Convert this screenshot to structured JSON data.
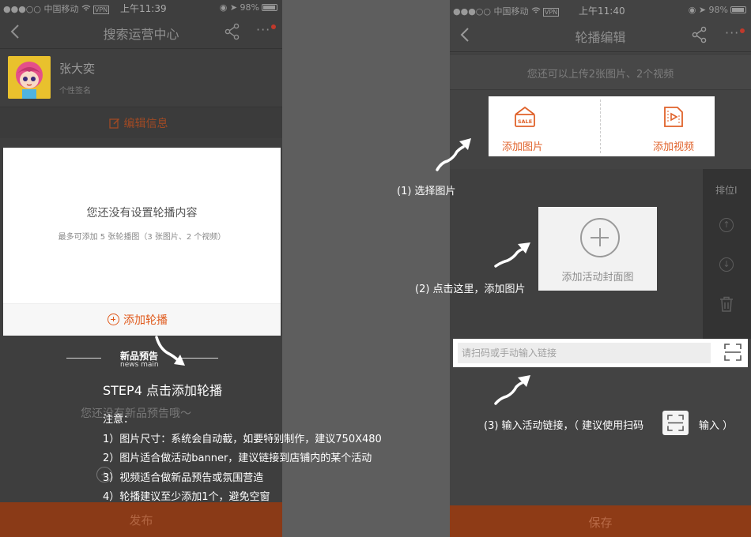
{
  "left_phone": {
    "status": {
      "carrier": "●●●○○ 中国移动",
      "vpn": "VPN",
      "time": "上午11:39",
      "battery": "98%"
    },
    "nav": {
      "title": "搜索运营中心",
      "more": "···"
    },
    "profile": {
      "name": "张大奕",
      "signature": "个性签名"
    },
    "edit_label": "编辑信息",
    "carousel_card": {
      "empty_title": "您还没有设置轮播内容",
      "empty_hint": "最多可添加 5 张轮播图（3 张图片、2 个视频）",
      "add_label": "添加轮播"
    },
    "new_product": {
      "title": "新品预告",
      "subtitle": "news main",
      "empty": "您还没有新品预告哦～"
    },
    "publish_label": "发布"
  },
  "instructions": {
    "step": "STEP4    点击添加轮播",
    "notes": [
      "注意：",
      "1）图片尺寸：系统会自动截，如要特别制作，建议750X480",
      "2）图片适合做活动banner，建议链接到店铺内的某个活动",
      "3）视频适合做新品预告或氛围营造",
      "4）轮播建议至少添加1个，避免空窗"
    ],
    "callout_1": "(1) 选择图片",
    "callout_2": "(2) 点击这里，添加图片",
    "callout_3a": "(3) 输入活动链接，（ 建议使用扫码",
    "callout_3b": "输入 ）"
  },
  "right_phone": {
    "status": {
      "carrier": "●●●○○ 中国移动",
      "vpn": "VPN",
      "time": "上午11:40",
      "battery": "98%"
    },
    "nav": {
      "title": "轮播编辑",
      "more": "···"
    },
    "quota": "您还可以上传2张图片、2个视频",
    "add_image_label": "添加图片",
    "add_video_label": "添加视频",
    "sale_text": "SALE",
    "rank_title": "排位I",
    "cover_label": "添加活动封面图",
    "link_placeholder": "请扫码或手动输入链接",
    "save_label": "保存"
  },
  "colors": {
    "accent": "#e0622a",
    "overlay": "#3e3e3e",
    "publish": "#8a3a17"
  }
}
